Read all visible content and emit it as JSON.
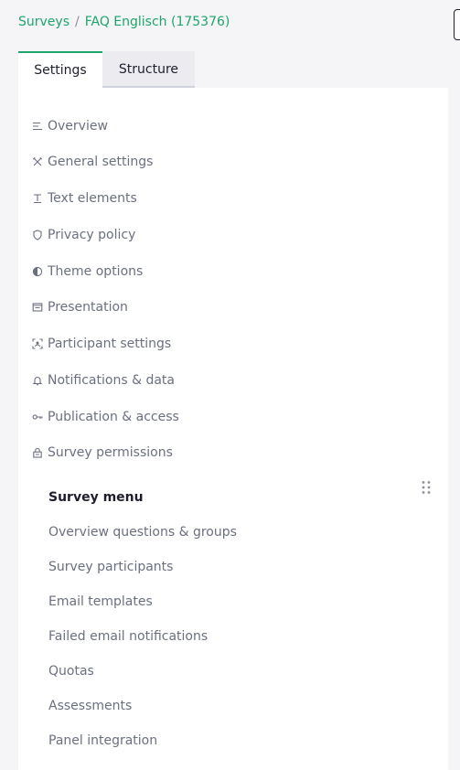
{
  "breadcrumb": {
    "root": "Surveys",
    "separator": "/",
    "current": "FAQ Englisch (175376)"
  },
  "tabs": [
    {
      "label": "Settings",
      "active": true
    },
    {
      "label": "Structure",
      "active": false
    }
  ],
  "settings_menu": [
    {
      "label": "Overview",
      "icon": "list-icon"
    },
    {
      "label": "General settings",
      "icon": "tools-icon"
    },
    {
      "label": "Text elements",
      "icon": "text-icon"
    },
    {
      "label": "Privacy policy",
      "icon": "shield-icon"
    },
    {
      "label": "Theme options",
      "icon": "contrast-icon"
    },
    {
      "label": "Presentation",
      "icon": "presentation-icon"
    },
    {
      "label": "Participant settings",
      "icon": "participant-icon"
    },
    {
      "label": "Notifications & data",
      "icon": "bell-icon"
    },
    {
      "label": "Publication & access",
      "icon": "key-icon"
    },
    {
      "label": "Survey permissions",
      "icon": "lock-icon"
    }
  ],
  "survey_menu": {
    "title": "Survey menu",
    "items": [
      "Overview questions & groups",
      "Survey participants",
      "Email templates",
      "Failed email notifications",
      "Quotas",
      "Assessments",
      "Panel integration"
    ]
  },
  "colors": {
    "accent": "#1ea56b",
    "muted_text": "#6b7080",
    "panel_bg": "#ffffff",
    "page_bg": "#f5f5f8"
  }
}
